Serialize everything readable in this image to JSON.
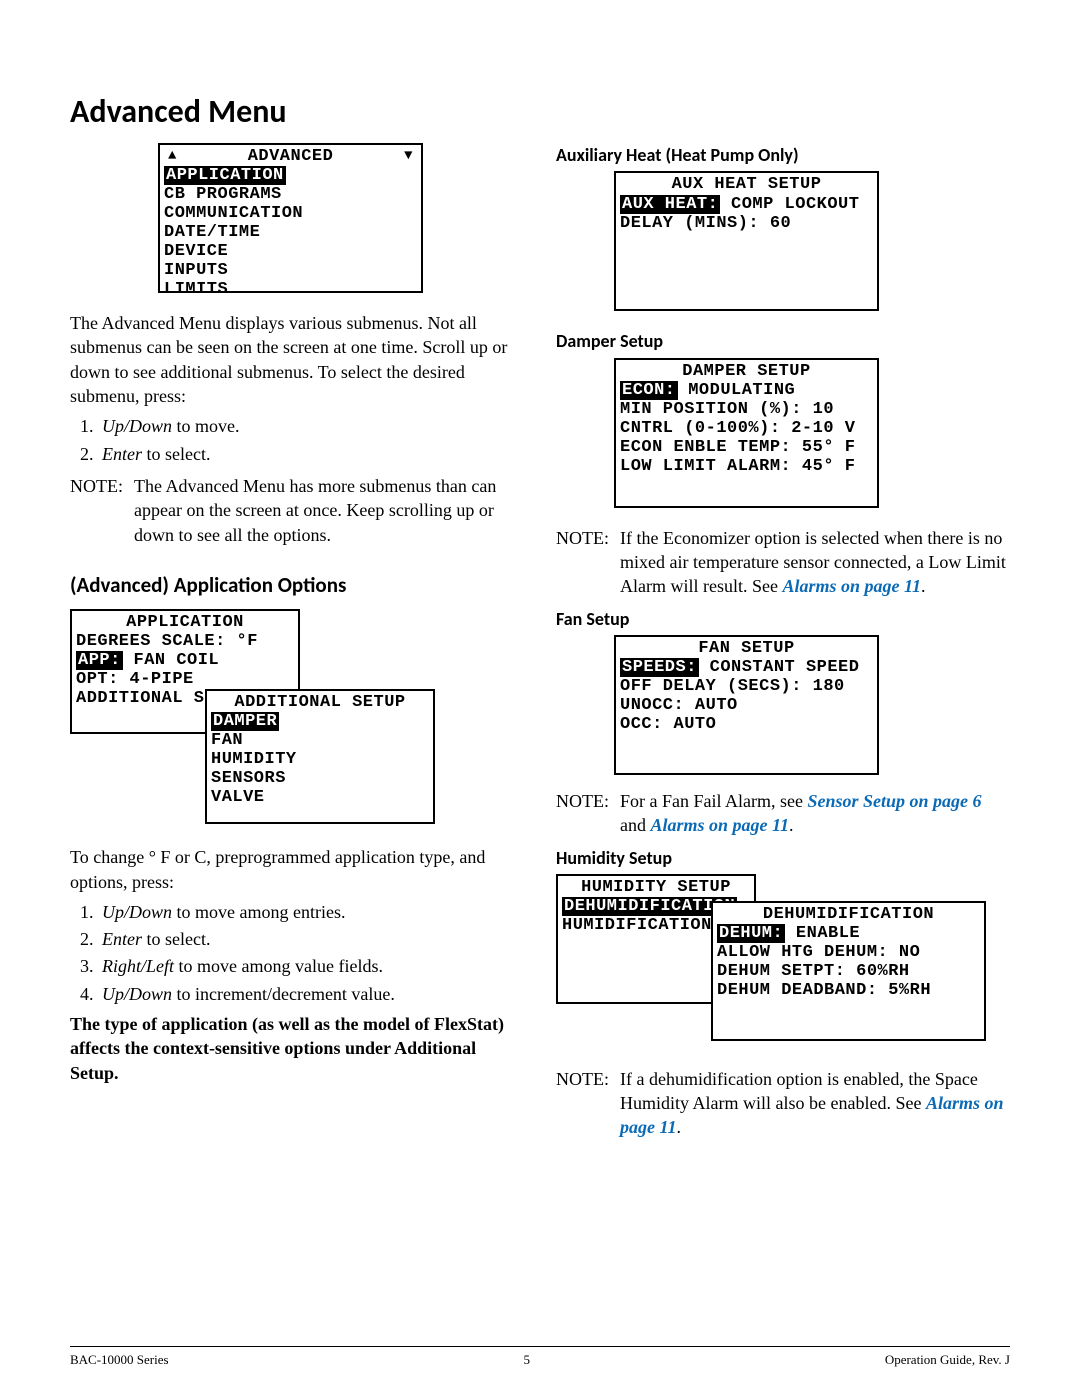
{
  "title": "Advanced Menu",
  "lcd_advanced": {
    "title": "ADVANCED",
    "items": [
      "APPLICATION",
      "CB PROGRAMS",
      "COMMUNICATION",
      "DATE/TIME",
      "DEVICE",
      "INPUTS",
      "LIMITS"
    ],
    "selected": 0
  },
  "intro_para": "The Advanced Menu displays various submenus. Not all submenus can be seen on the screen at one time. Scroll up or down to see additional submenus. To select the desired submenu, press:",
  "steps_basic": [
    {
      "italic": "Up/Down",
      "rest": " to move."
    },
    {
      "italic": "Enter",
      "rest": " to select."
    }
  ],
  "note_adv": {
    "label": "NOTE:",
    "body": "The Advanced Menu has more submenus than can appear on the screen at once. Keep scrolling up or down to see all the options."
  },
  "app_options_heading": "(Advanced) Application Options",
  "lcd_application": {
    "title": "APPLICATION",
    "lines": [
      {
        "text": "DEGREES SCALE: °F"
      },
      {
        "label": "APP:",
        "rest": " FAN COIL"
      },
      {
        "text": "OPT: 4-PIPE"
      },
      {
        "text": "ADDITIONAL SETUP"
      }
    ]
  },
  "lcd_additional_setup": {
    "title": "ADDITIONAL SETUP",
    "items": [
      "DAMPER",
      "FAN",
      "HUMIDITY",
      "SENSORS",
      "VALVE"
    ],
    "selected": 0
  },
  "change_para": "To change ° F or C, preprogrammed application type, and options, press:",
  "steps_extended": [
    {
      "italic": "Up/Down",
      "rest": " to move among entries."
    },
    {
      "italic": "Enter",
      "rest": " to select."
    },
    {
      "italic": "Right/Left",
      "rest": " to move among value fields."
    },
    {
      "italic": "Up/Down",
      "rest": " to increment/decrement value."
    }
  ],
  "bold_para": "The type of application (as well as the model of FlexStat) affects the context-sensitive options under Additional Setup.",
  "aux_heat_heading": "Auxiliary Heat (Heat Pump Only)",
  "lcd_aux_heat": {
    "title": "AUX HEAT SETUP",
    "lines": [
      {
        "label": "AUX HEAT:",
        "rest": " COMP LOCKOUT"
      },
      {
        "text": "DELAY (MINS): 60"
      }
    ]
  },
  "damper_heading": "Damper Setup",
  "lcd_damper": {
    "title": "DAMPER SETUP",
    "lines": [
      {
        "label": "ECON:",
        "rest": " MODULATING"
      },
      {
        "text": "MIN POSITION (%): 10"
      },
      {
        "text": "CNTRL (0-100%): 2-10 V"
      },
      {
        "text": "ECON ENBLE TEMP: 55° F"
      },
      {
        "text": "LOW LIMIT ALARM: 45° F"
      }
    ]
  },
  "note_damper": {
    "label": "NOTE:",
    "body_before": "If the Economizer option is selected when there is no mixed air temperature sensor connected, a Low Limit Alarm will result. See ",
    "link": "Alarms on page 11",
    "body_after": "."
  },
  "fan_heading": "Fan Setup",
  "lcd_fan": {
    "title": "FAN SETUP",
    "lines": [
      {
        "label": "SPEEDS:",
        "rest": " CONSTANT SPEED"
      },
      {
        "text": "OFF DELAY (SECS): 180"
      },
      {
        "text": "UNOCC: AUTO"
      },
      {
        "text": "OCC: AUTO"
      }
    ]
  },
  "note_fan": {
    "label": "NOTE:",
    "body_before": "For a Fan Fail Alarm, see ",
    "link1": "Sensor Setup on page 6",
    "mid": " and ",
    "link2": "Alarms on page 11",
    "body_after": "."
  },
  "humidity_heading": "Humidity Setup",
  "lcd_humidity_menu": {
    "title": "HUMIDITY SETUP",
    "items": [
      "DEHUMIDIFICATION",
      "HUMIDIFICATION"
    ],
    "selected": 0
  },
  "lcd_dehum": {
    "title": "DEHUMIDIFICATION",
    "lines": [
      {
        "label": "DEHUM:",
        "rest": " ENABLE"
      },
      {
        "text": "ALLOW HTG DEHUM: NO"
      },
      {
        "text": "DEHUM SETPT: 60%RH"
      },
      {
        "text": "DEHUM DEADBAND: 5%RH"
      }
    ]
  },
  "note_hum": {
    "label": "NOTE:",
    "body_before": "If a dehumidification option is enabled, the Space Humidity Alarm will also be enabled. See ",
    "link": "Alarms on page 11",
    "body_after": "."
  },
  "footer": {
    "left": "BAC-10000 Series",
    "center": "5",
    "right": "Operation Guide, Rev. J"
  }
}
